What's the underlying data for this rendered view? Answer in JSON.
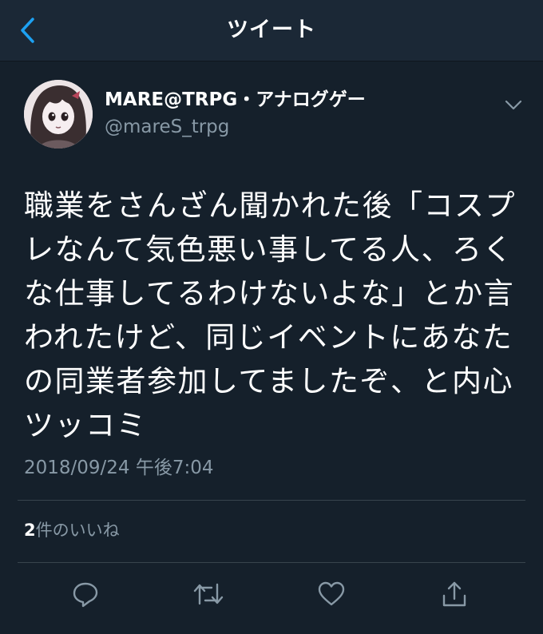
{
  "header": {
    "title": "ツイート",
    "back_icon": "chevron-left-icon",
    "accent": "#1da1f2"
  },
  "author": {
    "display_name": "MARE@TRPG・アナログゲー",
    "handle": "@mareS_trpg",
    "menu_icon": "chevron-down-icon"
  },
  "tweet": {
    "lines": [
      "職業をさんざん聞かれた後「コスプ",
      "レなんて気色悪い事してる人、ろく",
      "な仕事してるわけないよな」とか言",
      "われたけど、同じイベントにあなた",
      "の同業者参加してましたぞ、と内心",
      "ツッコミ"
    ],
    "timestamp": "2018/09/24 午後7:04"
  },
  "stats": {
    "likes_count": "2",
    "likes_label": "件のいいね"
  },
  "actions": {
    "reply_icon": "reply-icon",
    "retweet_icon": "retweet-icon",
    "like_icon": "heart-icon",
    "share_icon": "share-icon"
  },
  "colors": {
    "background": "#15202b",
    "header_background": "#1b2836",
    "text_primary": "#ffffff",
    "text_secondary": "#8899a6",
    "divider": "#38444d"
  }
}
